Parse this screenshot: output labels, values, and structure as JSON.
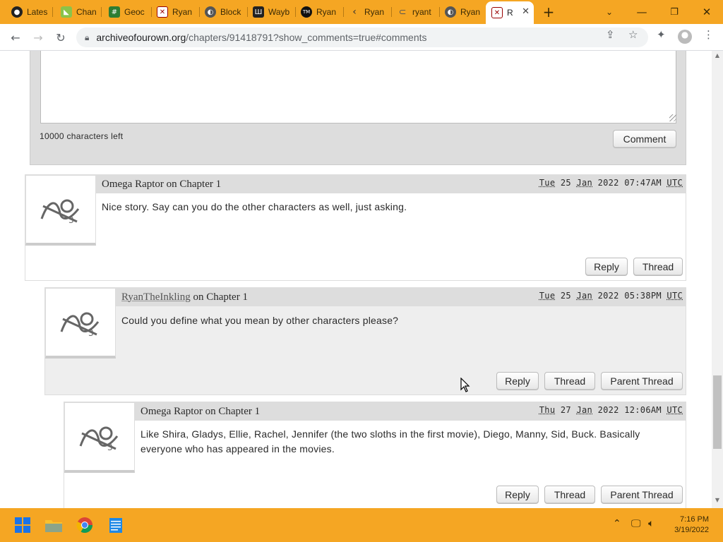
{
  "browser": {
    "tabs": [
      {
        "label": "Lates",
        "icon": "github-icon",
        "color": "#222222"
      },
      {
        "label": "Chan",
        "icon": "map-icon",
        "color": "#4caf50"
      },
      {
        "label": "Geoc",
        "icon": "grid-icon",
        "color": "#2e7d32"
      },
      {
        "label": "Ryan",
        "icon": "ao3-icon",
        "color": "#990000"
      },
      {
        "label": "Block",
        "icon": "globe-icon",
        "color": "#555555"
      },
      {
        "label": "Wayb",
        "icon": "archive-icon",
        "color": "#222222"
      },
      {
        "label": "Ryan",
        "icon": "tm-icon",
        "color": "#111111"
      },
      {
        "label": "Ryan",
        "icon": "back-arrow-icon",
        "color": "#333333"
      },
      {
        "label": "ryant",
        "icon": "chain-icon",
        "color": "#666666"
      },
      {
        "label": "Ryan",
        "icon": "globe-icon",
        "color": "#555555"
      },
      {
        "label": "R",
        "icon": "ao3-icon",
        "color": "#990000",
        "active": true
      }
    ],
    "new_tab_symbol": "+",
    "url_host": "archiveofourown.org",
    "url_path": "/chapters/91418791?show_comments=true#comments"
  },
  "comment_form": {
    "chars_left": "10000 characters left",
    "submit_label": "Comment"
  },
  "comments": [
    {
      "author": "Omega Raptor",
      "on_chapter": "on Chapter 1",
      "date_day": "Tue",
      "date_rest": "25",
      "date_month": "Jan",
      "date_time": "2022 07:47AM",
      "date_tz": "UTC",
      "body": "Nice story. Say can you do the other characters as well, just asking.",
      "reply_label": "Reply",
      "thread_label": "Thread"
    },
    {
      "author": "RyanTheInkling",
      "on_chapter": "on Chapter 1",
      "date_day": "Tue",
      "date_rest": "25",
      "date_month": "Jan",
      "date_time": "2022 05:38PM",
      "date_tz": "UTC",
      "body": "Could you define what you mean by other characters please?",
      "reply_label": "Reply",
      "thread_label": "Thread",
      "parent_label": "Parent Thread"
    },
    {
      "author": "Omega Raptor",
      "on_chapter": "on Chapter 1",
      "date_day": "Thu",
      "date_rest": "27",
      "date_month": "Jan",
      "date_time": "2022 12:06AM",
      "date_tz": "UTC",
      "body_line1": "Like Shira, Gladys, Ellie, Rachel, Jennifer (the two sloths in the first movie), Diego, Manny, Sid, Buck. Basically",
      "body_line2": "everyone who has appeared in the movies.",
      "reply_label": "Reply",
      "thread_label": "Thread",
      "parent_label": "Parent Thread"
    }
  ],
  "taskbar": {
    "time": "7:16 PM",
    "date": "3/19/2022"
  },
  "colors": {
    "accent": "#f5a623",
    "comment_header": "#dddddd",
    "nested_bg": "#eeeeee"
  }
}
